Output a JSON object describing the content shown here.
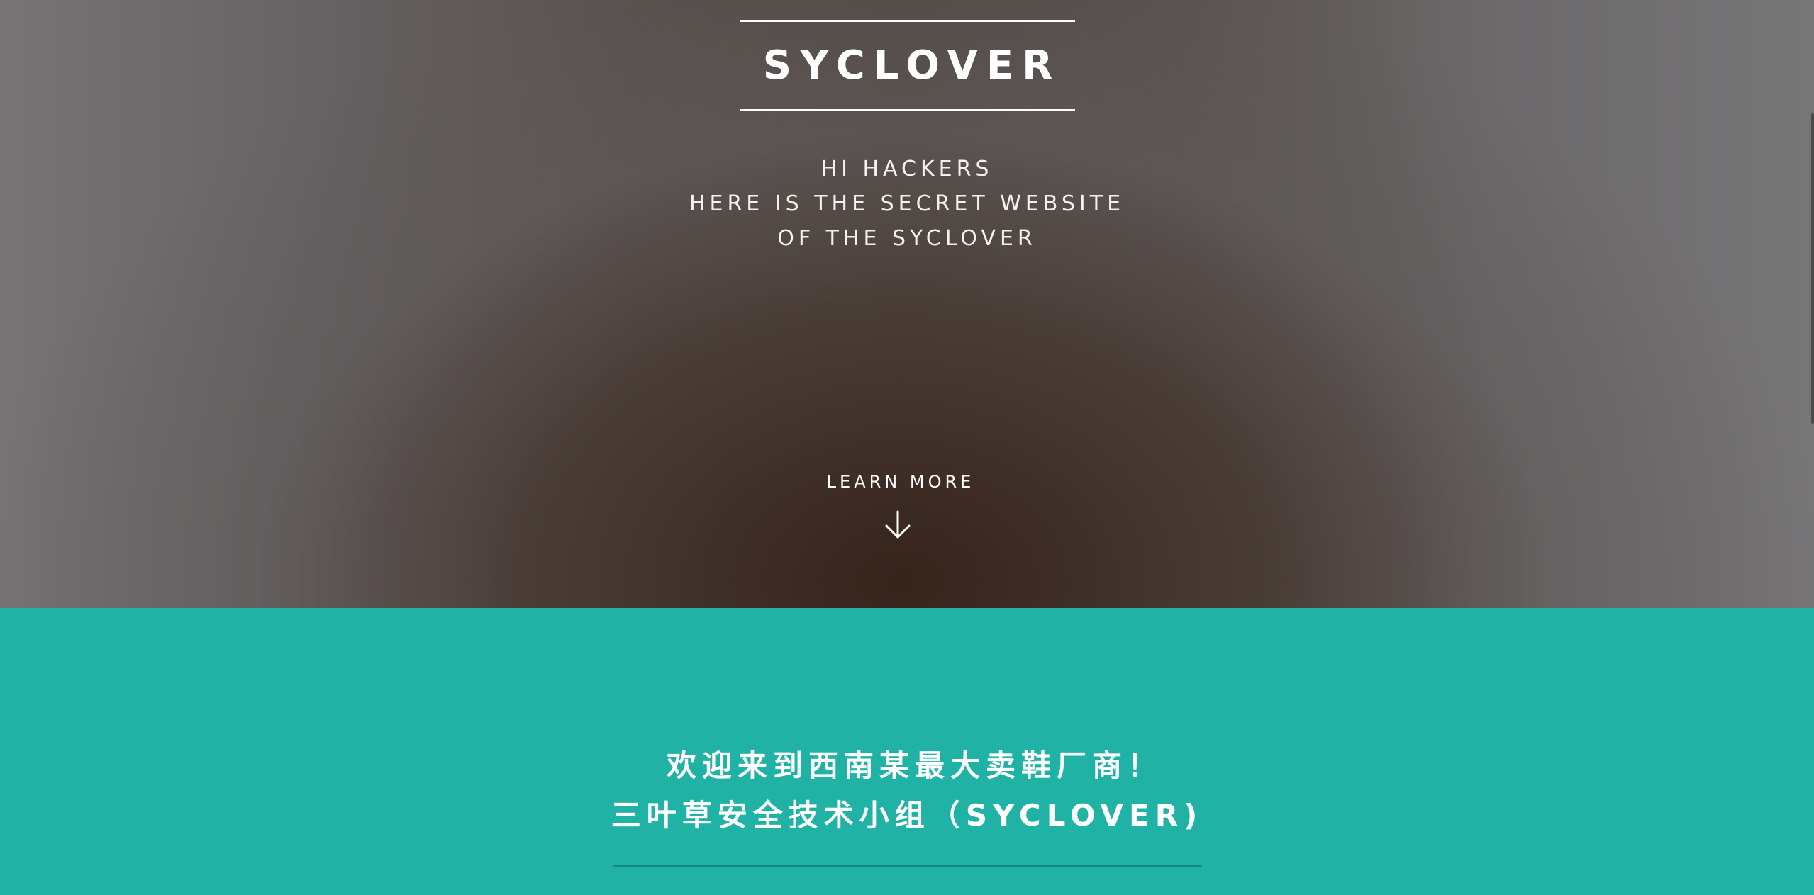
{
  "hero": {
    "brand": "SYCLOVER",
    "tagline": [
      "HI HACKERS",
      "HERE IS THE SECRET WEBSITE",
      "OF THE SYCLOVER"
    ],
    "learn_more": "LEARN MORE",
    "learn_more_icon": "arrow-down-icon"
  },
  "intro": {
    "heading_lines": [
      "欢迎来到西南某最大卖鞋厂商！",
      "三叶草安全技术小组（SYCLOVER)"
    ]
  },
  "colors": {
    "hero_overlay": "#4a3b34",
    "intro_background": "#20b2a5",
    "text": "#ffffff"
  }
}
